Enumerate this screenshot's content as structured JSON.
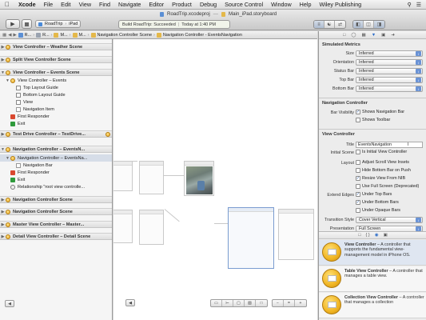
{
  "menubar": {
    "apple": "",
    "items": [
      "Xcode",
      "File",
      "Edit",
      "View",
      "Find",
      "Navigate",
      "Editor",
      "Product",
      "Debug",
      "Source Control",
      "Window",
      "Help",
      "Wiley Publishing"
    ]
  },
  "window": {
    "file_title": "RoadTrip.xcodeproj",
    "storyboard_title": "Main_iPad.storyboard",
    "scheme_target": "RoadTrip",
    "scheme_device": "iPad",
    "activity_status": "Build RoadTrip: Succeeded",
    "activity_time": "Today at 1:40 PM"
  },
  "jumpbar": {
    "crumbs": [
      "R...",
      "R...",
      "M...",
      "M...",
      "Navigation Controller Scene",
      "Navigation Controller - EventsNavigation"
    ]
  },
  "outline": {
    "rows": [
      {
        "type": "scene",
        "label": "View Controller – Weather Scene"
      },
      {
        "type": "scene",
        "label": "Split View Controller Scene"
      },
      {
        "type": "scene",
        "label": "View Controller – Events Scene"
      },
      {
        "type": "item",
        "label": "View Controller – Events"
      },
      {
        "type": "item",
        "label": "Top Layout Guide"
      },
      {
        "type": "item",
        "label": "Bottom Layout Guide"
      },
      {
        "type": "item",
        "label": "View"
      },
      {
        "type": "item",
        "label": "Navigation Item"
      },
      {
        "type": "item",
        "label": "First Responder"
      },
      {
        "type": "item",
        "label": "Exit"
      },
      {
        "type": "scene",
        "label": "Test Drive Controller – TestDrive..."
      },
      {
        "type": "scene",
        "label": "Navigation Controller – EventsN..."
      },
      {
        "type": "item",
        "label": "Navigation Controller – EventsNa..."
      },
      {
        "type": "item",
        "label": "Navigation Bar"
      },
      {
        "type": "item",
        "label": "First Responder"
      },
      {
        "type": "item",
        "label": "Exit"
      },
      {
        "type": "item",
        "label": "Relationship \"root view controlle..."
      },
      {
        "type": "scene",
        "label": "Navigation Controller Scene"
      },
      {
        "type": "scene",
        "label": "Navigation Controller Scene"
      },
      {
        "type": "scene",
        "label": "Master View Controller – Master..."
      },
      {
        "type": "scene",
        "label": "Detail View Controller – Detail Scene"
      }
    ]
  },
  "inspector": {
    "simulated_metrics": {
      "header": "Simulated Metrics",
      "fields": [
        {
          "label": "Size",
          "value": "Inferred"
        },
        {
          "label": "Orientation",
          "value": "Inferred"
        },
        {
          "label": "Status Bar",
          "value": "Inferred"
        },
        {
          "label": "Top Bar",
          "value": "Inferred"
        },
        {
          "label": "Bottom Bar",
          "value": "Inferred"
        }
      ]
    },
    "navigation_controller": {
      "header": "Navigation Controller",
      "bar_visibility_label": "Bar Visibility",
      "shows_navigation_bar": "Shows Navigation Bar",
      "shows_toolbar": "Shows Toolbar"
    },
    "view_controller": {
      "header": "View Controller",
      "title_label": "Title",
      "title_value": "EventsNavigation",
      "initial_scene_label": "Initial Scene",
      "is_initial": "Is Initial View Controller",
      "layout_label": "Layout",
      "adjust_scroll": "Adjust Scroll View Insets",
      "hide_bottom_bar": "Hide Bottom Bar on Push",
      "resize_view": "Resize View From NIB",
      "use_full_screen": "Use Full Screen (Deprecated)",
      "extend_edges_label": "Extend Edges",
      "under_top": "Under Top Bars",
      "under_bottom": "Under Bottom Bars",
      "under_opaque": "Under Opaque Bars",
      "transition_label": "Transition Style",
      "transition_value": "Cover Vertical",
      "presentation_label": "Presentation",
      "presentation_value": "Full Screen"
    }
  },
  "library": {
    "items": [
      {
        "title": "View Controller",
        "desc": " – A controller that supports the fundamental view-management model in iPhone OS."
      },
      {
        "title": "Table View Controller",
        "desc": " – A controller that manages a table view."
      },
      {
        "title": "Collection View Controller",
        "desc": " – A controller that manages a collection"
      }
    ]
  },
  "colors": {
    "selection": "#d6dde8",
    "accent": "#2a6bc8",
    "status_ok": "#f1f4ea"
  }
}
